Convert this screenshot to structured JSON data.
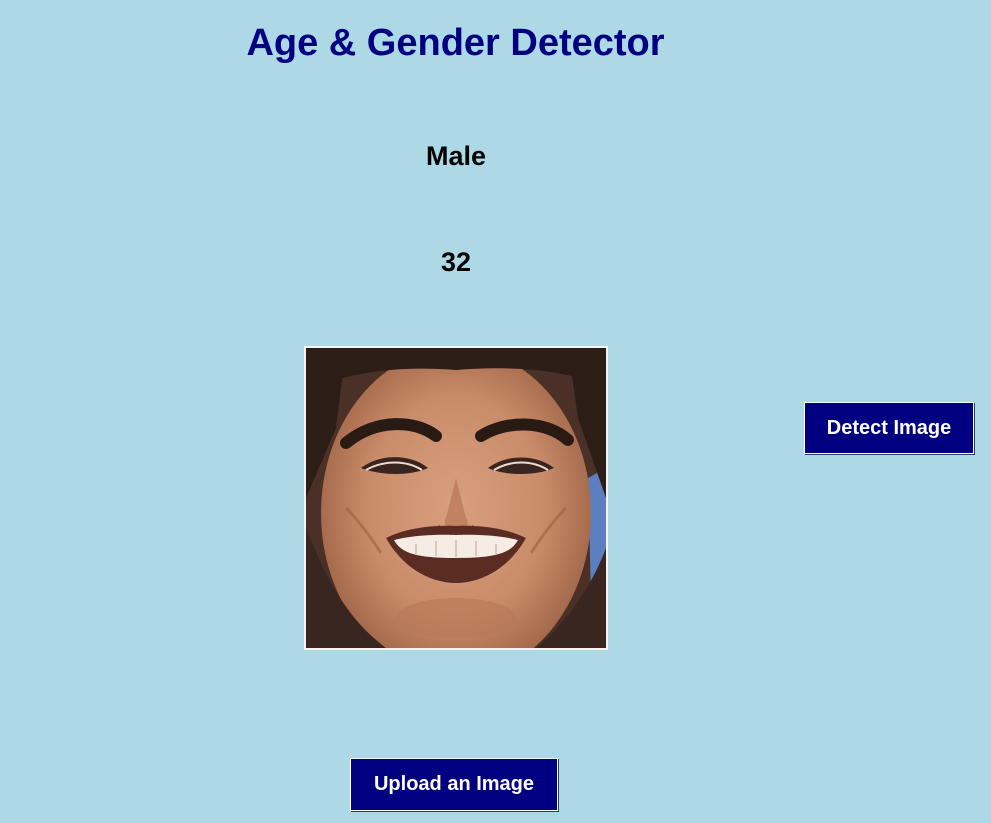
{
  "header": {
    "title": "Age & Gender Detector"
  },
  "result": {
    "gender": "Male",
    "age": "32"
  },
  "image": {
    "description_icon": "face-photo"
  },
  "buttons": {
    "detect_label": "Detect Image",
    "upload_label": "Upload an Image"
  },
  "colors": {
    "background": "#add8e6",
    "title": "#000080",
    "button_bg": "#000080",
    "button_text": "#ffffff"
  }
}
